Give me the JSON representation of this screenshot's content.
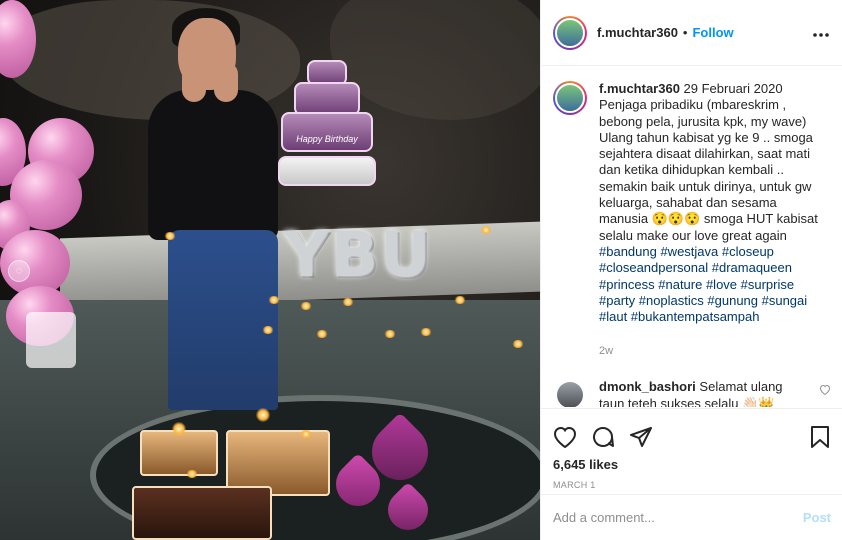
{
  "header": {
    "username": "f.muchtar360",
    "separator": "•",
    "follow_label": "Follow",
    "more_icon": "ellipsis-icon"
  },
  "photo": {
    "balloon_letters": "YBU",
    "cake_banner": "Happy Birthday"
  },
  "caption": {
    "username": "f.muchtar360",
    "date": "29 Februari 2020",
    "text": "Penjaga pribadiku (mbareskrim , bebong pela, jurusita kpk, my wave) Ulang tahun kabisat yg ke 9 .. smoga sejahtera disaat dilahirkan, saat mati dan ketika dihidupkan kembali .. semakin baik untuk dirinya, untuk gw keluarga, sahabat dan sesama manusia 😯😯😯 smoga HUT kabisat selalu make our love great again",
    "hashtags_line1": "#bandung #westjava #closeup",
    "hashtags_line2": "#closeandpersonal #dramaqueen",
    "hashtags_line3": "#princess #nature #love #surprise",
    "hashtags_line4": "#party #noplastics #gunung #sungai",
    "hashtags_line5": "#laut #bukantempatsampah",
    "age": "2w"
  },
  "comment": {
    "username": "dmonk_bashori",
    "text": "Selamat ulang taun teteh sukses selalu 👋🏻👑"
  },
  "actions": {
    "likes": "6,645 likes",
    "date": "MARCH 1"
  },
  "add_comment": {
    "placeholder": "Add a comment...",
    "post_label": "Post"
  },
  "colors": {
    "follow": "#0095f6",
    "post_disabled": "#b2dffc",
    "hashtag": "#00376b",
    "muted": "#8e8e8e"
  }
}
